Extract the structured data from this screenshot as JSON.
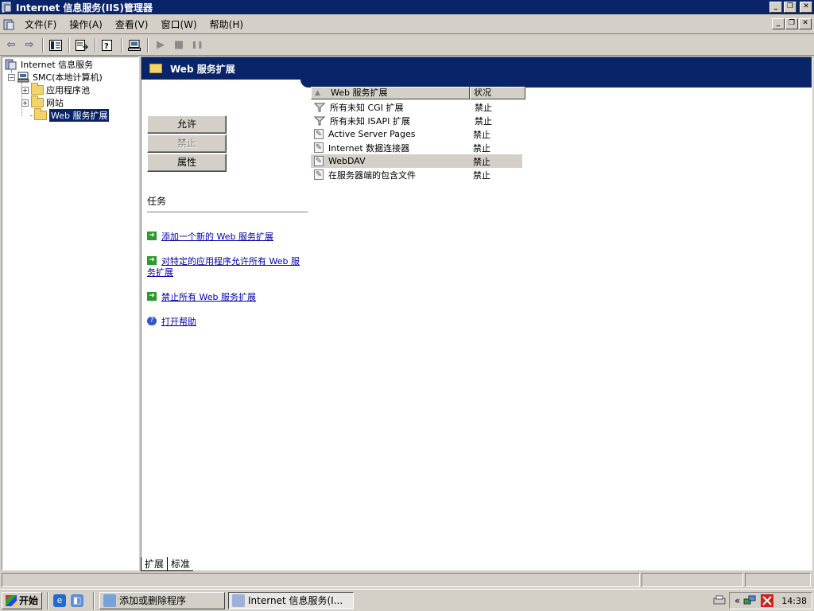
{
  "window": {
    "title": "Internet 信息服务(IIS)管理器",
    "controls": {
      "minimize": "_",
      "restore": "❐",
      "close": "✕"
    }
  },
  "menu": {
    "items": [
      "文件(F)",
      "操作(A)",
      "查看(V)",
      "窗口(W)",
      "帮助(H)"
    ]
  },
  "toolbar": {
    "back_glyph": "⇦",
    "forward_glyph": "⇨",
    "play_glyph": "▶",
    "stop_glyph": "■",
    "pause_glyph": "❚❚"
  },
  "tree": {
    "root": "Internet 信息服务",
    "server": "SMC(本地计算机)",
    "children": [
      "应用程序池",
      "网站",
      "Web 服务扩展"
    ],
    "selected": "Web 服务扩展"
  },
  "banner": {
    "title": "Web 服务扩展"
  },
  "actions": {
    "allow": "允许",
    "prohibit": "禁止",
    "properties": "属性"
  },
  "tasks": {
    "heading": "任务",
    "items": [
      "添加一个新的 Web 服务扩展",
      "对特定的应用程序允许所有 Web 服务扩展",
      "禁止所有 Web 服务扩展",
      "打开帮助"
    ]
  },
  "list": {
    "columns": [
      "Web 服务扩展",
      "状况"
    ],
    "rows": [
      {
        "name": "所有未知 CGI 扩展",
        "status": "禁止",
        "icon": "filter-icon"
      },
      {
        "name": "所有未知 ISAPI 扩展",
        "status": "禁止",
        "icon": "filter-icon"
      },
      {
        "name": "Active Server Pages",
        "status": "禁止",
        "icon": "page-icon"
      },
      {
        "name": "Internet 数据连接器",
        "status": "禁止",
        "icon": "page-icon"
      },
      {
        "name": "WebDAV",
        "status": "禁止",
        "icon": "page-icon"
      },
      {
        "name": "在服务器端的包含文件",
        "status": "禁止",
        "icon": "page-icon"
      }
    ]
  },
  "view_tabs": [
    "扩展",
    "标准"
  ],
  "taskbar": {
    "start": "开始",
    "buttons": [
      "添加或删除程序",
      "Internet 信息服务(I..."
    ],
    "tray_chevron": "«",
    "clock": "14:38"
  },
  "colors": {
    "title_bg": "#0a246a",
    "link": "#0000aa",
    "face": "#d4d0c8"
  }
}
